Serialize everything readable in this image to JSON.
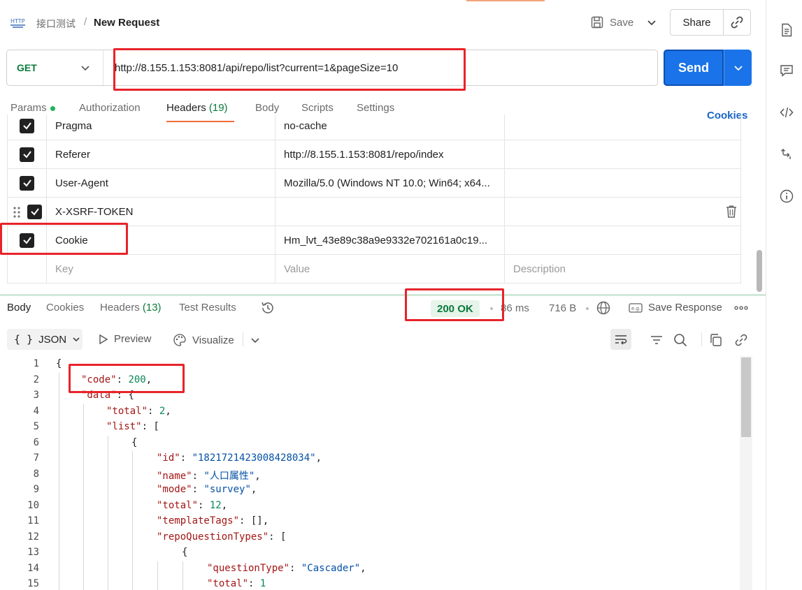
{
  "breadcrumb": {
    "collection": "接口测试",
    "separator": "/",
    "request": "New Request"
  },
  "toolbar": {
    "save_label": "Save",
    "share_label": "Share"
  },
  "request": {
    "method": "GET",
    "url": "http://8.155.1.153:8081/api/repo/list?current=1&pageSize=10",
    "send_label": "Send"
  },
  "request_tabs": {
    "params": "Params",
    "authorization": "Authorization",
    "headers": "Headers",
    "headers_count": "(19)",
    "body": "Body",
    "scripts": "Scripts",
    "settings": "Settings",
    "cookies_link": "Cookies"
  },
  "headers_table": {
    "rows": [
      {
        "key": "Pragma",
        "value": "no-cache",
        "description": ""
      },
      {
        "key": "Referer",
        "value": "http://8.155.1.153:8081/repo/index",
        "description": ""
      },
      {
        "key": "User-Agent",
        "value": "Mozilla/5.0 (Windows NT 10.0; Win64; x64...",
        "description": ""
      },
      {
        "key": "X-XSRF-TOKEN",
        "value": "",
        "description": ""
      },
      {
        "key": "Cookie",
        "value": "Hm_lvt_43e89c38a9e9332e702161a0c19...",
        "description": ""
      }
    ],
    "placeholders": {
      "key": "Key",
      "value": "Value",
      "description": "Description"
    }
  },
  "response_tabs": {
    "body": "Body",
    "cookies": "Cookies",
    "headers": "Headers",
    "headers_count": "(13)",
    "test_results": "Test Results"
  },
  "response_meta": {
    "status": "200 OK",
    "time": "86 ms",
    "size": "716 B",
    "save_response": "Save Response",
    "status_color": "#0a7a3b"
  },
  "response_toolbar": {
    "format": "JSON",
    "preview": "Preview",
    "visualize": "Visualize"
  },
  "code": {
    "line_numbers": [
      "1",
      "2",
      "3",
      "4",
      "5",
      "6",
      "7",
      "8",
      "9",
      "10",
      "11",
      "12",
      "13",
      "14",
      "15"
    ],
    "l1": "{",
    "l2_key": "\"code\"",
    "l2_val": "200",
    "l3_key": "\"data\"",
    "l3_punct": ": {",
    "l4_key": "\"total\"",
    "l4_val": "2",
    "l5_key": "\"list\"",
    "l5_punct": ": [",
    "l6": "{",
    "l7_key": "\"id\"",
    "l7_val": "\"1821721423008428034\"",
    "l8_key": "\"name\"",
    "l8_val": "\"人口属性\"",
    "l9_key": "\"mode\"",
    "l9_val": "\"survey\"",
    "l10_key": "\"total\"",
    "l10_val": "12",
    "l11_key": "\"templateTags\"",
    "l11_punct": ": [],",
    "l12_key": "\"repoQuestionTypes\"",
    "l12_punct": ": [",
    "l13": "{",
    "l14_key": "\"questionType\"",
    "l14_val": "\"Cascader\"",
    "l15_key": "\"total\"",
    "l15_val": "1"
  },
  "colors": {
    "send_blue": "#1a73e8",
    "highlight_red": "#e8232a",
    "json_key": "#a31515",
    "json_string": "#0451a5",
    "json_number": "#098658"
  }
}
